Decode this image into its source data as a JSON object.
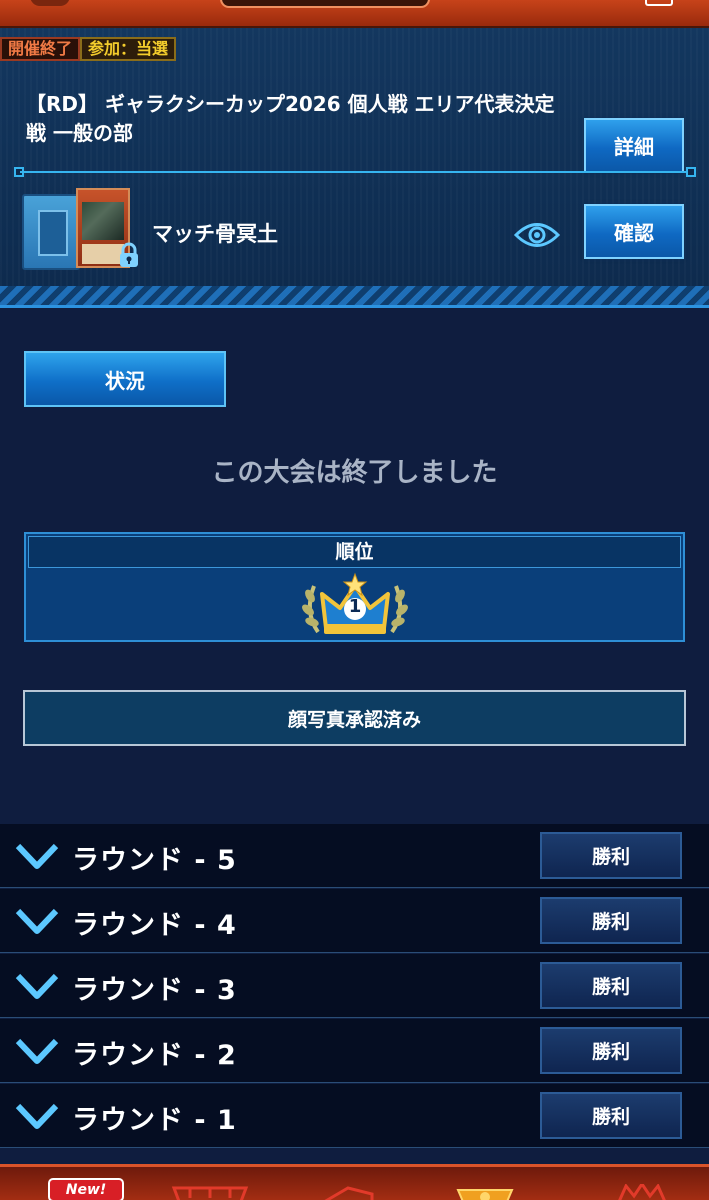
{
  "tournament": {
    "status_badge": "開催終了",
    "entry_badge": "参加：当選",
    "title": "【RD】 ギャラクシーカップ2026 個人戦 エリア代表決定戦 一般の部",
    "detail_button": "詳細"
  },
  "deck": {
    "name": "マッチ骨冥土",
    "confirm_button": "確認"
  },
  "main": {
    "status_tab": "状況",
    "ended_message": "この大会は終了しました",
    "rank_header": "順位",
    "rank_value": "1",
    "face_photo_status": "顔写真承認済み"
  },
  "rounds": [
    {
      "label": "ラウンド - 5",
      "result": "勝利"
    },
    {
      "label": "ラウンド - 4",
      "result": "勝利"
    },
    {
      "label": "ラウンド - 3",
      "result": "勝利"
    },
    {
      "label": "ラウンド - 2",
      "result": "勝利"
    },
    {
      "label": "ラウンド - 1",
      "result": "勝利"
    }
  ],
  "bottom_nav": {
    "new_badge": "New!"
  },
  "colors": {
    "accent_blue": "#2fa0ec",
    "panel_bg": "#0f1d3f",
    "badge_gold": "#f3cc2c",
    "nav_orange": "#c7431a"
  }
}
